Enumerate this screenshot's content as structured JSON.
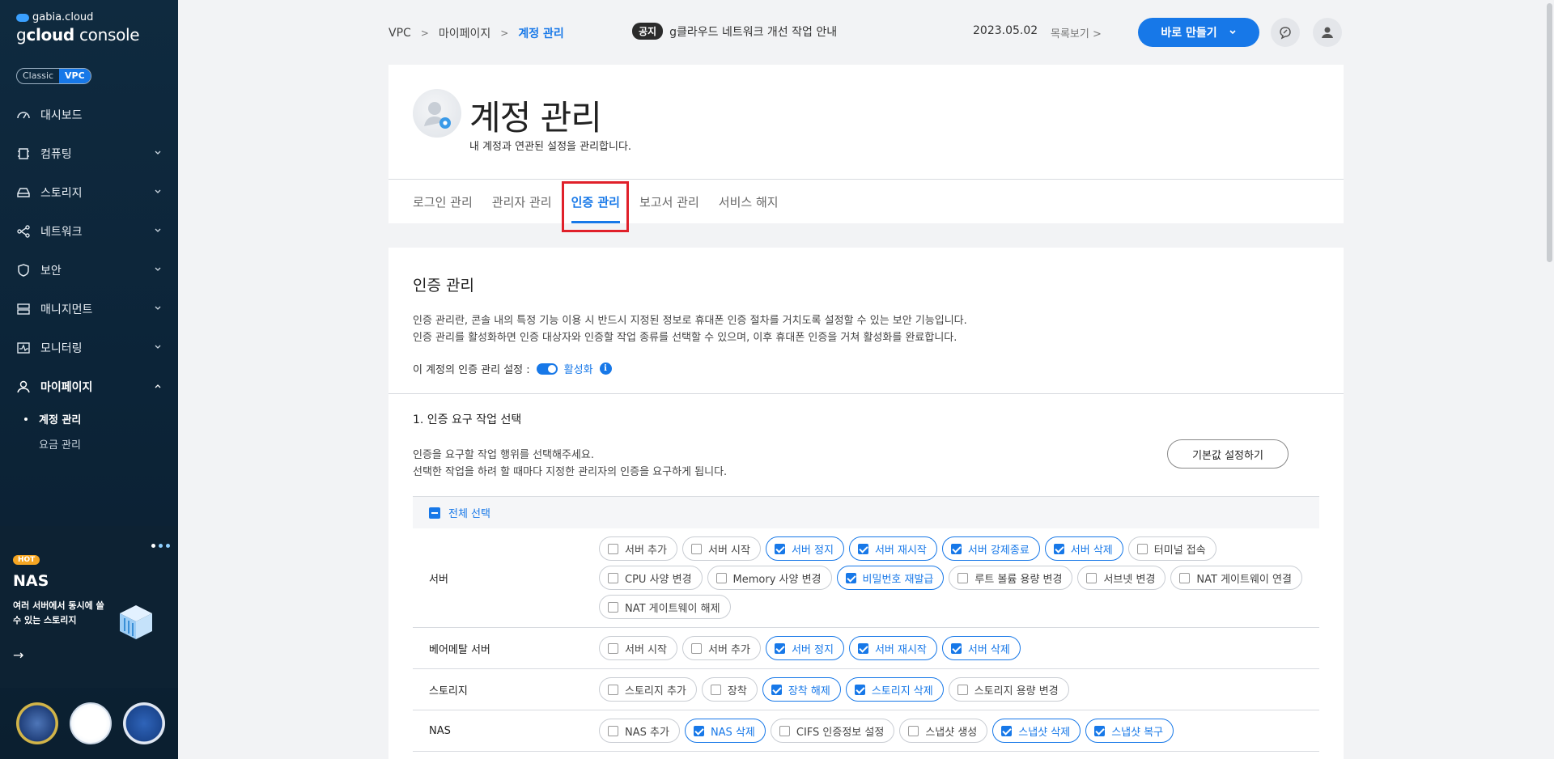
{
  "sidebar": {
    "brand": "gabia.cloud",
    "console_prefix": "g",
    "console_bold": "cloud",
    "console_suffix": " console",
    "mode": {
      "classic": "Classic",
      "vpc": "VPC"
    },
    "items": [
      {
        "label": "대시보드",
        "icon": "dashboard-icon"
      },
      {
        "label": "컴퓨팅",
        "icon": "chip-icon"
      },
      {
        "label": "스토리지",
        "icon": "storage-icon"
      },
      {
        "label": "네트워크",
        "icon": "network-icon"
      },
      {
        "label": "보안",
        "icon": "shield-icon"
      },
      {
        "label": "매니지먼트",
        "icon": "management-icon"
      },
      {
        "label": "모니터링",
        "icon": "monitoring-icon"
      },
      {
        "label": "마이페이지",
        "icon": "user-icon"
      }
    ],
    "subitems": [
      "계정 관리",
      "요금 관리"
    ]
  },
  "promo": {
    "hot": "HOT",
    "title": "NAS",
    "desc": "여러 서버에서 동시에 쓸 수 있는 스토리지",
    "arrow": "→"
  },
  "topbar": {
    "breadcrumb": [
      "VPC",
      "마이페이지",
      "계정 관리"
    ],
    "notice_tag": "공지",
    "notice_text": "g클라우드 네트워크 개선 작업 안내",
    "date": "2023.05.02",
    "list_view": "목록보기",
    "create_button": "바로 만들기"
  },
  "header": {
    "title": "계정 관리",
    "subtitle": "내 계정과 연관된 설정을 관리합니다.",
    "tabs": [
      "로그인 관리",
      "관리자 관리",
      "인증 관리",
      "보고서 관리",
      "서비스 해지"
    ]
  },
  "auth": {
    "title": "인증 관리",
    "intro1": "인증 관리란, 콘솔 내의 특정 기능 이용 시 반드시 지정된 정보로 휴대폰 인증 절차를 거치도록 설정할 수 있는 보안 기능입니다.",
    "intro2": "인증 관리를 활성화하면 인증 대상자와 인증할 작업 종류를 선택할 수 있으며, 이후 휴대폰 인증을 거쳐 활성화를 완료합니다.",
    "setting_label": "이 계정의 인증 관리 설정 :",
    "setting_value": "활성화",
    "step_title": "1. 인증 요구 작업 선택",
    "step_desc1": "인증을 요구할 작업 행위를 선택해주세요.",
    "step_desc2": "선택한 작업을 하려 할 때마다 지정한 관리자의 인증을 요구하게 됩니다.",
    "default_button": "기본값 설정하기",
    "select_all": "전체 선택",
    "rows": [
      {
        "label": "서버",
        "chips": [
          {
            "t": "서버 추가",
            "on": false
          },
          {
            "t": "서버 시작",
            "on": false
          },
          {
            "t": "서버 정지",
            "on": true
          },
          {
            "t": "서버 재시작",
            "on": true
          },
          {
            "t": "서버 강제종료",
            "on": true
          },
          {
            "t": "서버 삭제",
            "on": true
          },
          {
            "t": "터미널 접속",
            "on": false
          },
          {
            "t": "CPU 사양 변경",
            "on": false
          },
          {
            "t": "Memory 사양 변경",
            "on": false
          },
          {
            "t": "비밀번호 재발급",
            "on": true
          },
          {
            "t": "루트 볼륨 용량 변경",
            "on": false
          },
          {
            "t": "서브넷 변경",
            "on": false
          },
          {
            "t": "NAT 게이트웨이 연결",
            "on": false
          },
          {
            "t": "NAT 게이트웨이 해제",
            "on": false
          }
        ]
      },
      {
        "label": "베어메탈 서버",
        "chips": [
          {
            "t": "서버 시작",
            "on": false
          },
          {
            "t": "서버 추가",
            "on": false
          },
          {
            "t": "서버 정지",
            "on": true
          },
          {
            "t": "서버 재시작",
            "on": true
          },
          {
            "t": "서버 삭제",
            "on": true
          }
        ]
      },
      {
        "label": "스토리지",
        "chips": [
          {
            "t": "스토리지 추가",
            "on": false
          },
          {
            "t": "장착",
            "on": false
          },
          {
            "t": "장착 해제",
            "on": true
          },
          {
            "t": "스토리지 삭제",
            "on": true
          },
          {
            "t": "스토리지 용량 변경",
            "on": false
          }
        ]
      },
      {
        "label": "NAS",
        "chips": [
          {
            "t": "NAS 추가",
            "on": false
          },
          {
            "t": "NAS 삭제",
            "on": true
          },
          {
            "t": "CIFS 인증정보 설정",
            "on": false
          },
          {
            "t": "스냅샷 생성",
            "on": false
          },
          {
            "t": "스냅샷 삭제",
            "on": true
          },
          {
            "t": "스냅샷 복구",
            "on": true
          }
        ]
      }
    ]
  },
  "colors": {
    "accent": "#1778e8",
    "sidebar": "#0f2a3f",
    "highlight": "#e0202a"
  }
}
